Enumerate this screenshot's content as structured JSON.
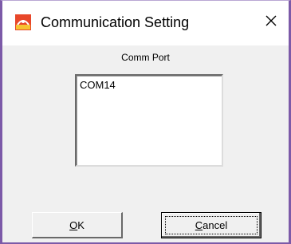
{
  "window": {
    "title": "Communication Setting",
    "close_symbol": "×",
    "app_icon": "app-icon",
    "border_color": "#7c5aa8"
  },
  "port_section": {
    "label": "Comm Port",
    "items": [
      "COM14"
    ]
  },
  "buttons": {
    "ok_label": "OK",
    "cancel_label": "Cancel"
  }
}
